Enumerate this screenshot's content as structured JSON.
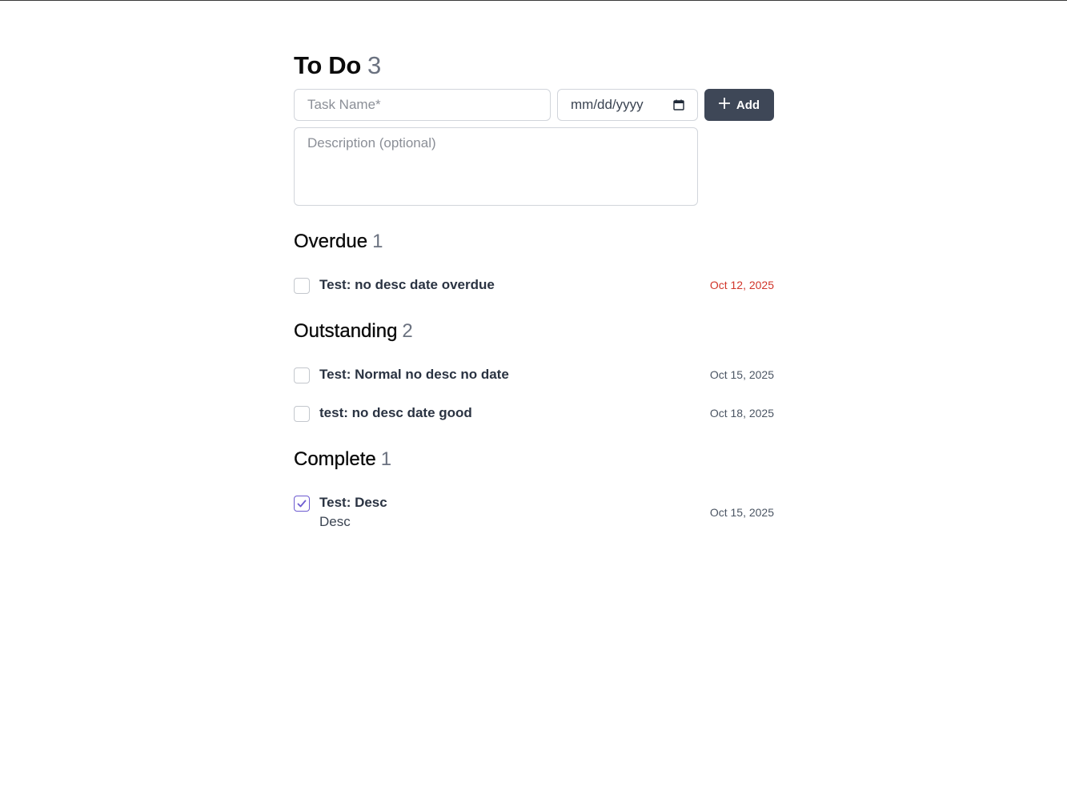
{
  "header": {
    "title": "To Do",
    "count": "3"
  },
  "form": {
    "task_name_placeholder": "Task Name*",
    "task_name_value": "",
    "date_placeholder": "mm/dd/yyyy",
    "date_value": "",
    "add_label": "Add",
    "description_placeholder": "Description (optional)",
    "description_value": ""
  },
  "sections": {
    "overdue": {
      "title": "Overdue",
      "count": "1",
      "tasks": [
        {
          "name": "Test: no desc date overdue",
          "date": "Oct 12, 2025",
          "checked": false
        }
      ]
    },
    "outstanding": {
      "title": "Outstanding",
      "count": "2",
      "tasks": [
        {
          "name": "Test: Normal no desc no date",
          "date": "Oct 15, 2025",
          "checked": false
        },
        {
          "name": "test: no desc date good",
          "date": "Oct 18, 2025",
          "checked": false
        }
      ]
    },
    "complete": {
      "title": "Complete",
      "count": "1",
      "tasks": [
        {
          "name": "Test: Desc",
          "description": "Desc",
          "date": "Oct 15, 2025",
          "checked": true
        }
      ]
    }
  },
  "colors": {
    "primary_button": "#3e4757",
    "overdue_date": "#d1352a",
    "checkbox_checked": "#6d5bd0",
    "muted_count": "#6b7280"
  }
}
